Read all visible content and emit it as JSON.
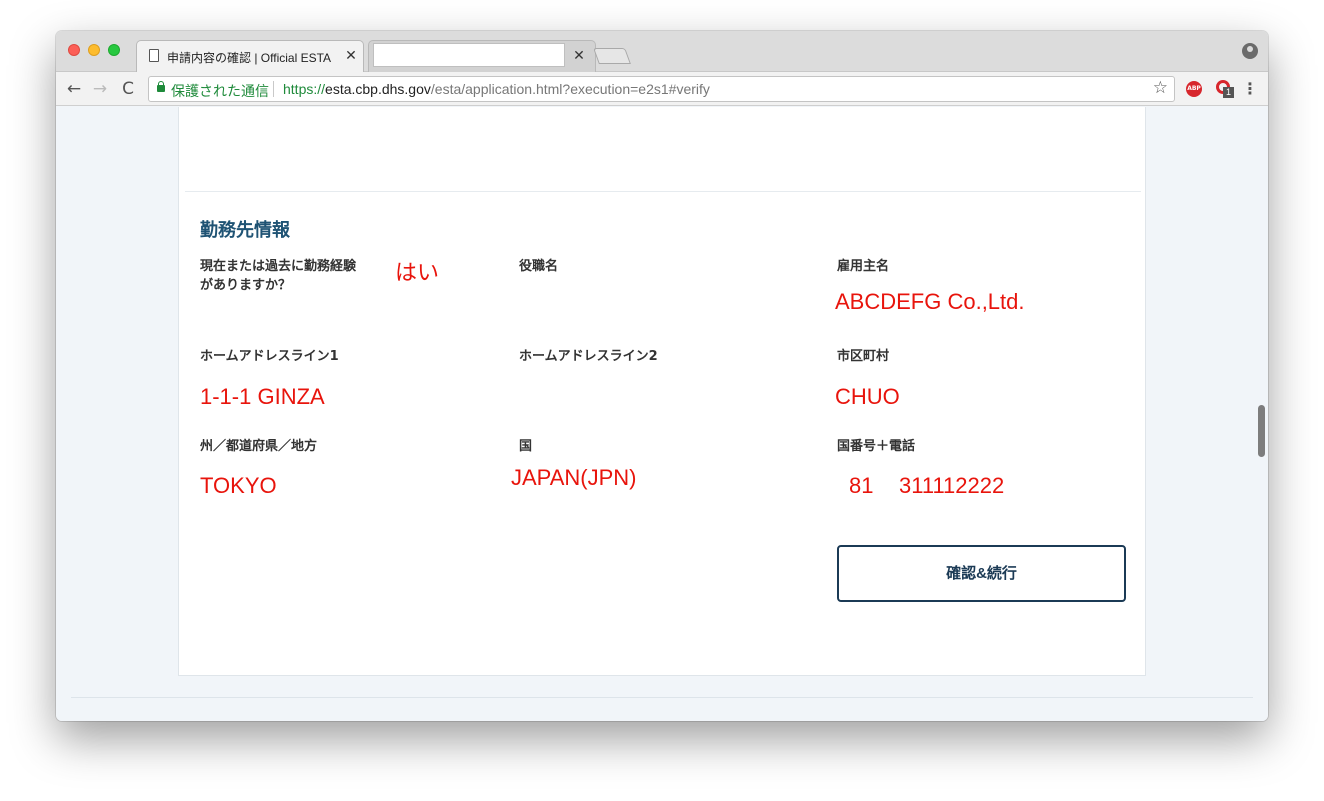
{
  "browser": {
    "active_tab": {
      "title": "申請内容の確認 | Official ESTA",
      "close": "✕"
    },
    "second_tab": {
      "close": "✕"
    },
    "omnibox": {
      "secure_label": "保護された通信",
      "url_scheme": "https://",
      "url_host": "esta.cbp.dhs.gov",
      "url_path": "/esta/application.html?execution=e2s1#verify"
    },
    "icons": {
      "back": "←",
      "forward": "→",
      "reload": "C",
      "star": "☆",
      "abp": "ABP",
      "ext_badge": "1",
      "menu": "⋮"
    }
  },
  "section": {
    "title": "勤務先情報"
  },
  "fields": {
    "employment": {
      "label_line1": "現在または過去に勤務経験",
      "label_line2": "がありますか？",
      "value": "はい"
    },
    "job_title": {
      "label": "役職名",
      "value": ""
    },
    "employer_name": {
      "label": "雇用主名",
      "value": "ABCDEFG Co.,Ltd."
    },
    "address_line1": {
      "label": "ホームアドレスライン1",
      "value": "1-1-1 GINZA"
    },
    "address_line2": {
      "label": "ホームアドレスライン2",
      "value": ""
    },
    "city": {
      "label": "市区町村",
      "value": "CHUO"
    },
    "state": {
      "label": "州／都道府県／地方",
      "value": "TOKYO"
    },
    "country": {
      "label": "国",
      "value": "JAPAN(JPN)"
    },
    "phone": {
      "label": "国番号＋電話",
      "country_code": "81",
      "number": "311112222"
    }
  },
  "actions": {
    "confirm_label": "確認&続行"
  },
  "colors": {
    "heading": "#1f5374",
    "annotation_red": "#e8140c",
    "button_border": "#1b3a55",
    "secure_green": "#1e8a3a"
  }
}
